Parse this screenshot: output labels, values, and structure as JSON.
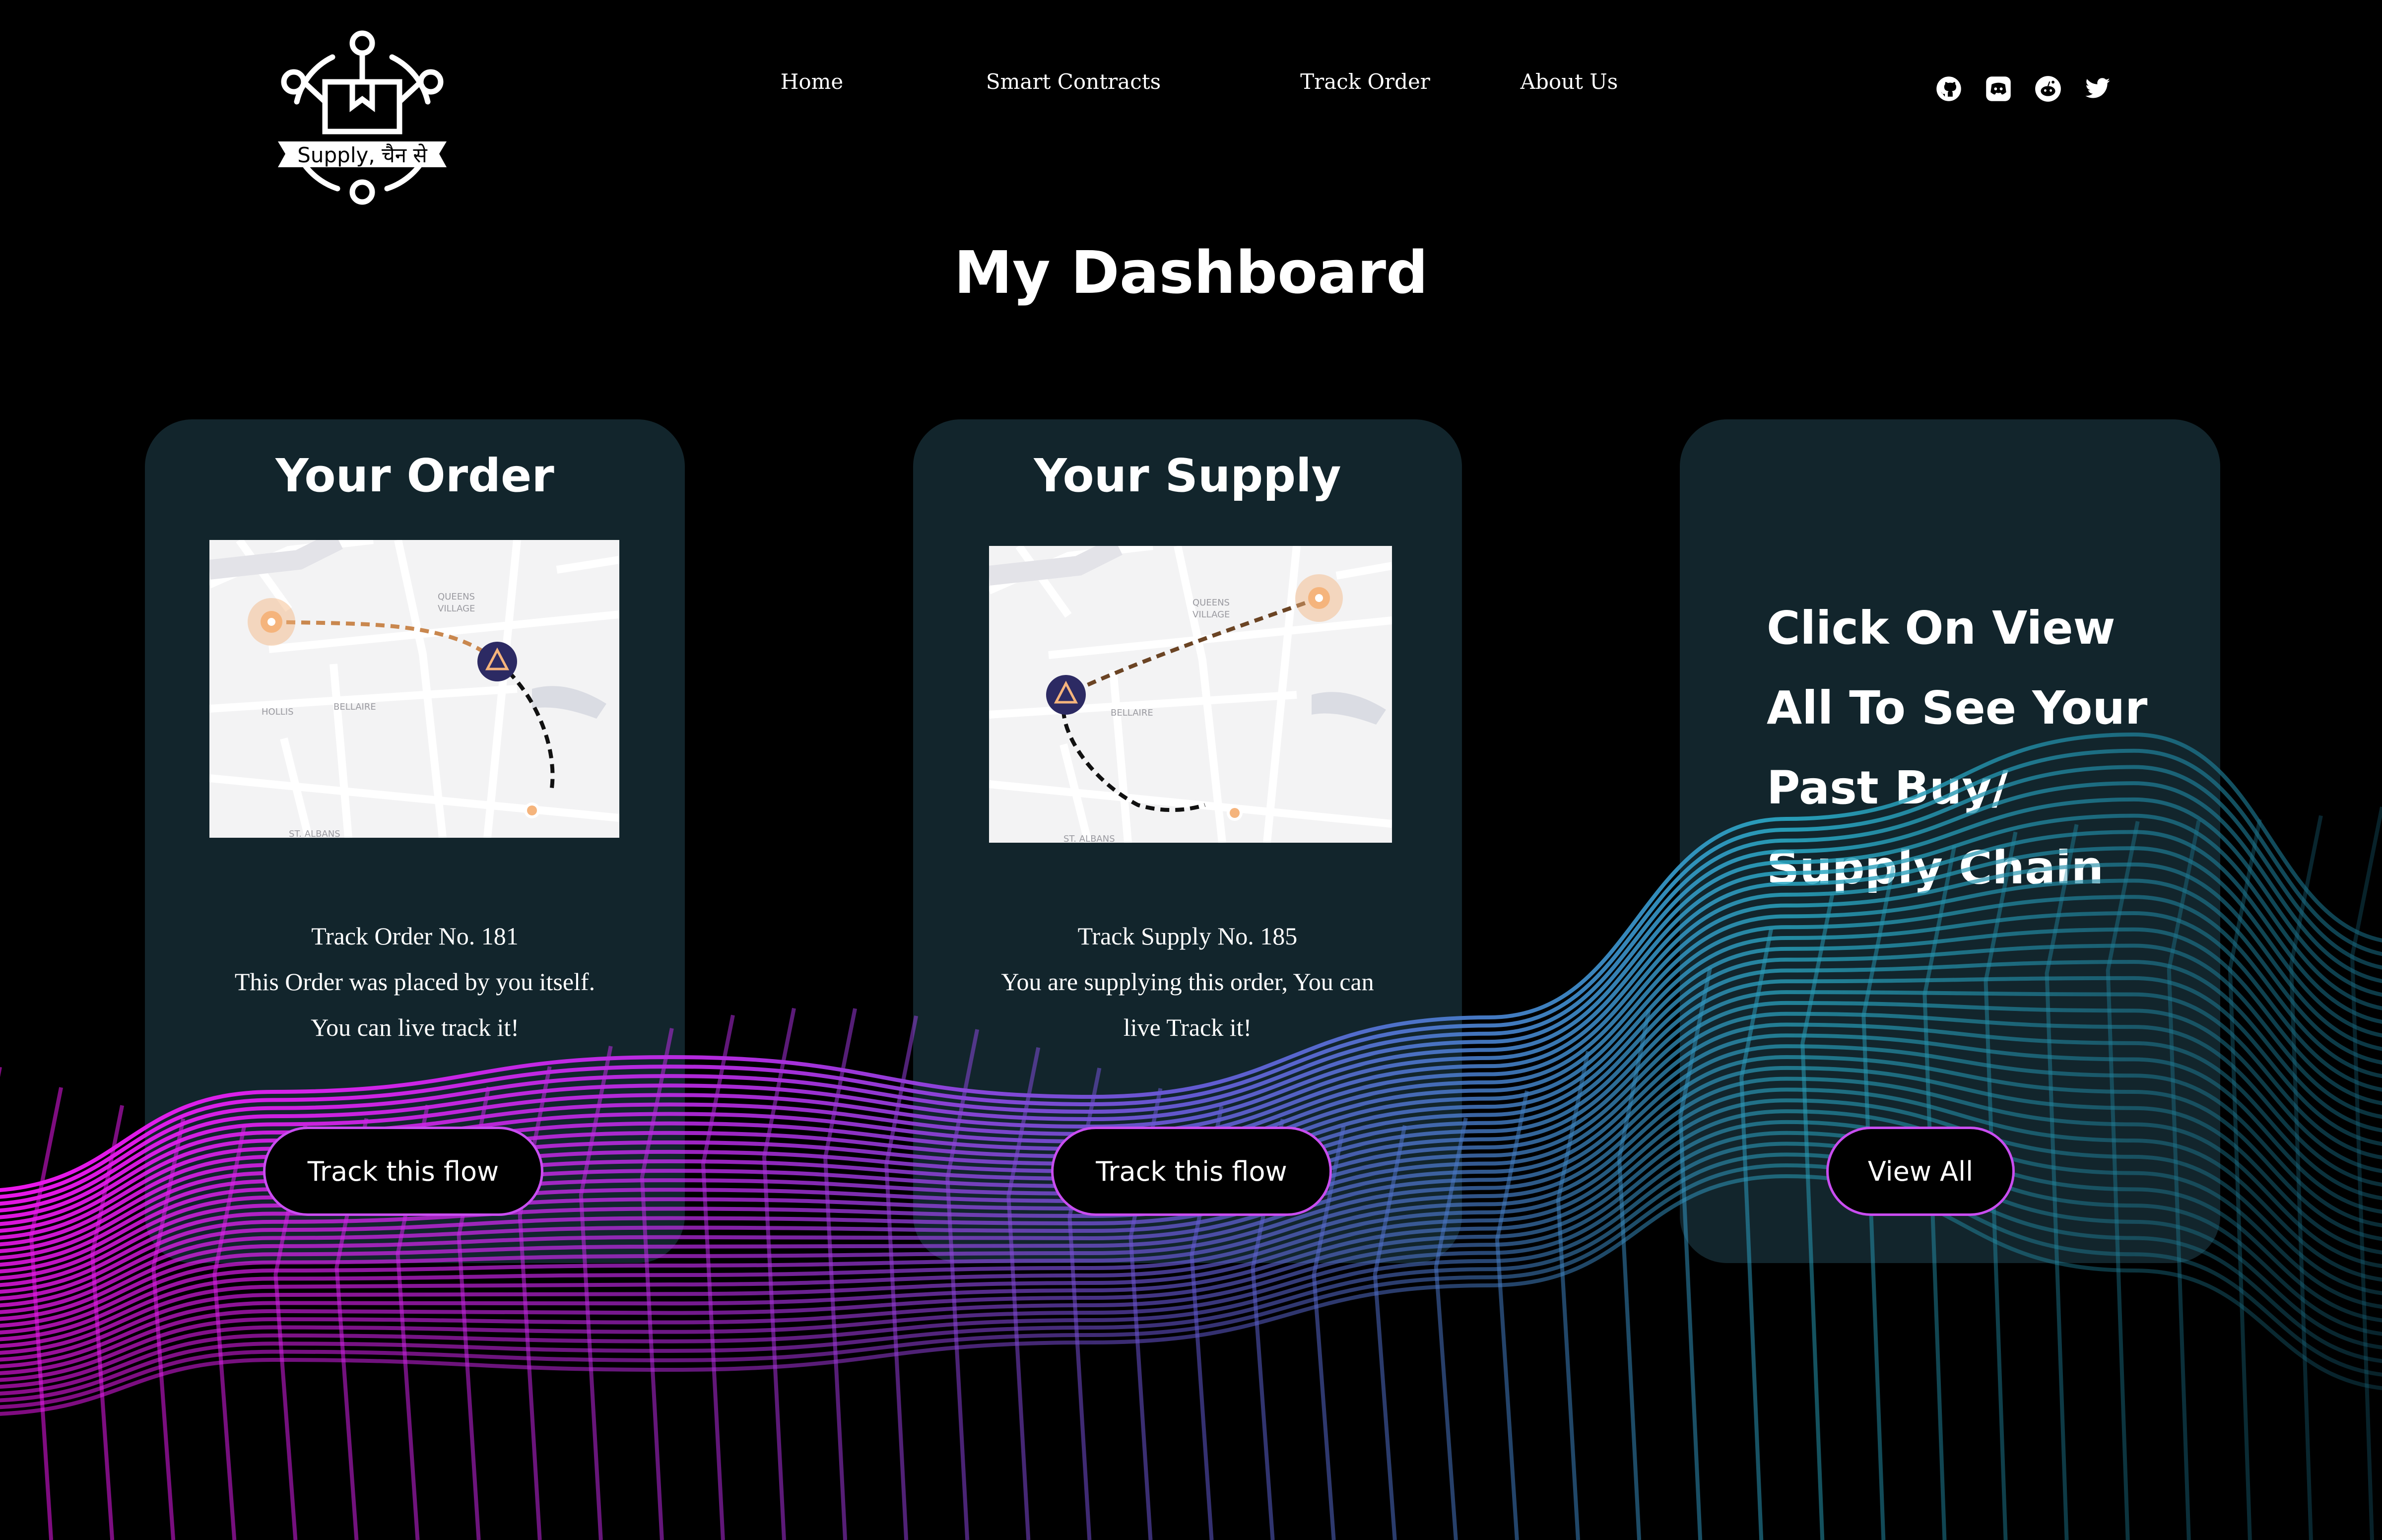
{
  "brand": {
    "logo_text": "Supply, चैन से"
  },
  "nav": {
    "items": [
      {
        "label": "Home"
      },
      {
        "label": "Smart Contracts"
      },
      {
        "label": "Track Order"
      },
      {
        "label": "About Us"
      }
    ],
    "social_icons": [
      "github-icon",
      "discord-icon",
      "reddit-icon",
      "twitter-icon"
    ]
  },
  "page": {
    "title": "My Dashboard"
  },
  "cards": {
    "order": {
      "title": "Your Order",
      "map_labels": [
        "QUEENS",
        "VILLAGE",
        "HOLLIS",
        "BELLAIRE",
        "ST. ALBANS"
      ],
      "line1": "Track Order No. 181",
      "line2": "This Order was placed by you itself.",
      "line3": "You can live track it!",
      "button": "Track this flow"
    },
    "supply": {
      "title": "Your Supply",
      "map_labels": [
        "QUEENS",
        "VILLAGE",
        "BELLAIRE",
        "ST. ALBANS"
      ],
      "line1": "Track Supply No. 185",
      "line2": "You are supplying this order, You can",
      "line3": "live Track it!",
      "button": "Track this flow"
    },
    "history": {
      "line1": "Click On View",
      "line2": "All To See Your",
      "line3": "Past Buy/",
      "line4": "Supply Chain",
      "button": "View All"
    }
  },
  "colors": {
    "background": "#000000",
    "card": "#12252c",
    "route_order": "#c9874e",
    "route_supply": "#6b4424",
    "marker_orange": "#f5b47c",
    "truck_marker": "#2c2a63",
    "wave_magenta": "#ff19ff",
    "wave_cyan": "#2aa8c4"
  }
}
